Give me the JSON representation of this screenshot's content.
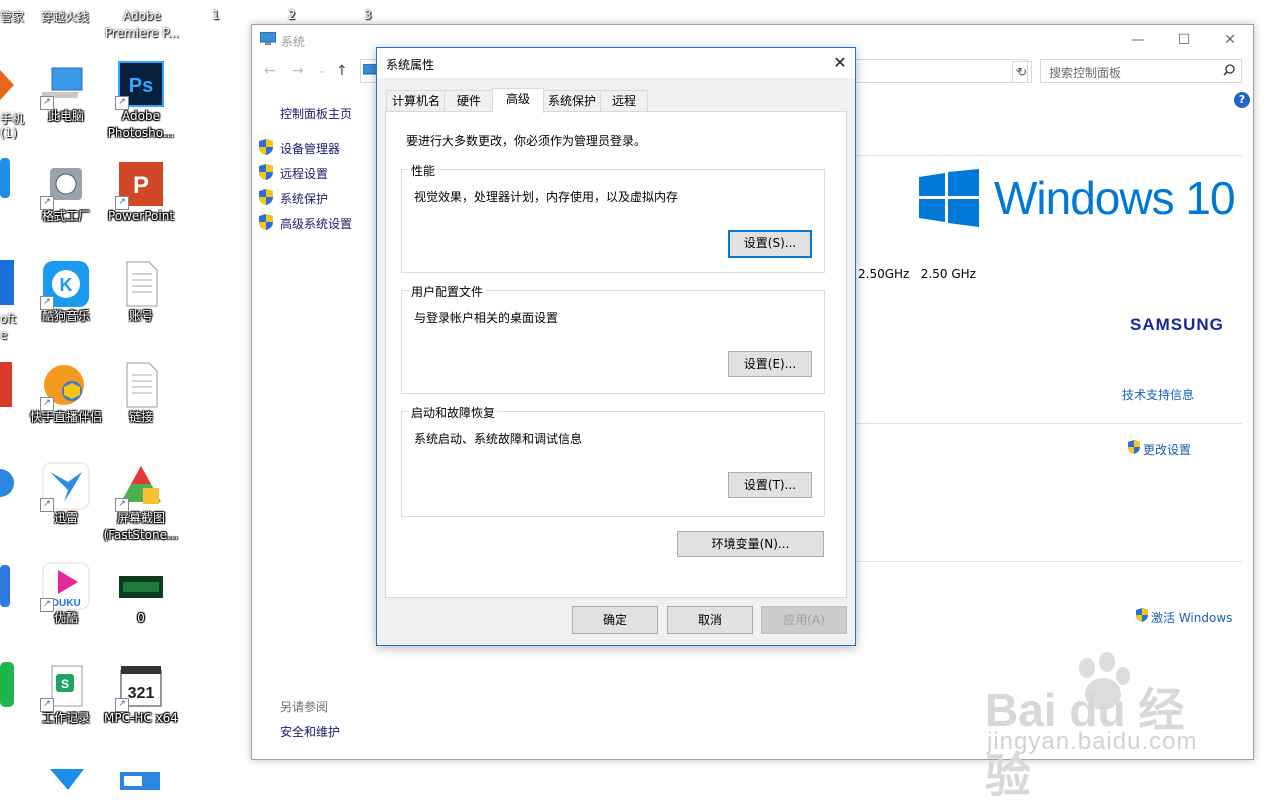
{
  "desktop": {
    "top_labels": [
      "管家",
      "穿越火线",
      "Adobe Premiere P...",
      "1",
      "2",
      "3"
    ],
    "icons": [
      {
        "label": "此电脑",
        "icon": "computer-icon"
      },
      {
        "label": "Adobe Photosho...",
        "icon": "photoshop-icon"
      },
      {
        "label": "格式工厂",
        "icon": "format-factory-icon"
      },
      {
        "label": "PowerPoint",
        "icon": "powerpoint-icon"
      },
      {
        "label": "酷狗音乐",
        "icon": "kugou-icon"
      },
      {
        "label": "账号",
        "icon": "text-file-icon"
      },
      {
        "label": "快手直播伴侣",
        "icon": "kuaishou-icon"
      },
      {
        "label": "链接",
        "icon": "text-file-icon"
      },
      {
        "label": "迅雷",
        "icon": "xunlei-icon"
      },
      {
        "label": "屏幕截图 (FastStone...",
        "icon": "faststone-icon"
      },
      {
        "label": "优酷",
        "icon": "youku-icon"
      },
      {
        "label": "0",
        "icon": "image-thumb-icon"
      },
      {
        "label": "工作记录",
        "icon": "spreadsheet-icon"
      },
      {
        "label": "MPC-HC x64",
        "icon": "mpc-hc-icon"
      }
    ],
    "edge_labels": [
      "手机",
      "(1)",
      "oft",
      "e"
    ]
  },
  "system_window": {
    "title": "系统",
    "controls": {
      "minimize": "—",
      "maximize": "☐",
      "close": "✕"
    },
    "search_placeholder": "搜索控制面板",
    "left_pane": {
      "home": "控制面板主页",
      "items": [
        "设备管理器",
        "远程设置",
        "系统保护",
        "高级系统设置"
      ],
      "see_also": "另请参阅",
      "security": "安全和维护"
    },
    "right_pane": {
      "os_name": "Windows 10",
      "cpu_speed": "2.50GHz   2.50 GHz",
      "manufacturer": "SAMSUNG",
      "support_link": "技术支持信息",
      "change_settings": "更改设置",
      "activate": "激活 Windows"
    }
  },
  "dialog": {
    "title": "系统属性",
    "tabs": [
      "计算机名",
      "硬件",
      "高级",
      "系统保护",
      "远程"
    ],
    "active_tab": "高级",
    "admin_note": "要进行大多数更改，你必须作为管理员登录。",
    "groups": [
      {
        "title": "性能",
        "desc": "视觉效果，处理器计划，内存使用，以及虚拟内存",
        "button": "设置(S)..."
      },
      {
        "title": "用户配置文件",
        "desc": "与登录帐户相关的桌面设置",
        "button": "设置(E)..."
      },
      {
        "title": "启动和故障恢复",
        "desc": "系统启动、系统故障和调试信息",
        "button": "设置(T)..."
      }
    ],
    "env_button": "环境变量(N)...",
    "ok": "确定",
    "cancel": "取消",
    "apply": "应用(A)"
  },
  "watermark": {
    "brand": "Bai du 经验",
    "url": "jingyan.baidu.com"
  },
  "colors": {
    "accent": "#0078d7",
    "link": "#1a5fb4",
    "samsung": "#1428a0"
  }
}
